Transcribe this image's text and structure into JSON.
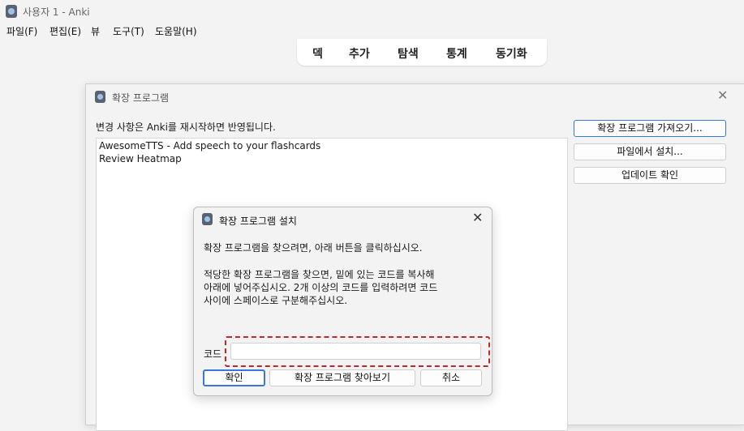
{
  "window": {
    "title": "사용자 1 - Anki"
  },
  "menubar": {
    "file": "파일(F)",
    "edit": "편집(E)",
    "view": "뷰",
    "tools": "도구(T)",
    "help": "도움말(H)"
  },
  "toolbar": {
    "decks": "덱",
    "add": "추가",
    "browse": "탐색",
    "stats": "통계",
    "sync": "동기화"
  },
  "addons_window": {
    "title": "확장 프로그램",
    "restart_note": "변경 사항은 Anki를 재시작하면 반영됩니다.",
    "addons": [
      "AwesomeTTS - Add speech to your flashcards",
      "Review Heatmap"
    ],
    "buttons": {
      "get_addons": "확장 프로그램 가져오기...",
      "install_from_file": "파일에서 설치...",
      "check_updates": "업데이트 확인"
    }
  },
  "install_dialog": {
    "title": "확장 프로그램 설치",
    "instruction_1": "확장 프로그램을 찾으려면, 아래 버튼을 클릭하십시오.",
    "instruction_2_line1": "적당한 확장 프로그램을 찾으면, 밑에 있는 코드를 복사해",
    "instruction_2_line2": "아래에 넣어주십시오. 2개 이상의 코드를 입력하려면 코드",
    "instruction_2_line3": "사이에 스페이스로 구분해주십시오.",
    "code_label": "코드",
    "code_value": "",
    "buttons": {
      "ok": "확인",
      "browse_addons": "확장 프로그램 찾아보기",
      "cancel": "취소"
    }
  },
  "colors": {
    "accent": "#3a78d8",
    "highlight": "#c4262e",
    "background": "#f3f3f3"
  },
  "icons": [
    "anki-app-icon",
    "close-icon"
  ]
}
